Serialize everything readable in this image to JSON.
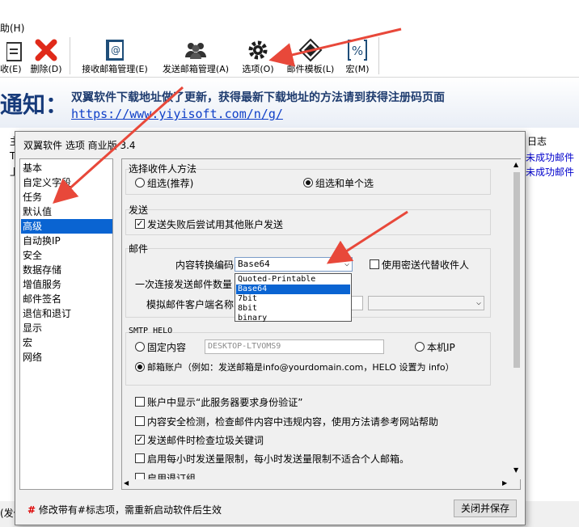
{
  "menubar": {
    "help_label": "助(H)"
  },
  "toolbar": {
    "items": [
      {
        "label": "收(E)",
        "icon": "receive-icon"
      },
      {
        "label": "删除(D)",
        "icon": "delete-x-icon"
      },
      {
        "label": "接收邮箱管理(E)",
        "icon": "receive-mailbox-icon"
      },
      {
        "label": "发送邮箱管理(A)",
        "icon": "users-icon"
      },
      {
        "label": "选项(O)",
        "icon": "gear-icon"
      },
      {
        "label": "邮件模板(L)",
        "icon": "template-icon"
      },
      {
        "label": "宏(M)",
        "icon": "percent-macro-icon"
      }
    ]
  },
  "banner": {
    "title": "通知：",
    "text": "双翼软件下载地址做了更新，获得最新下载地址的方法请到获得注册码页面",
    "link": "https://www.yiyisoft.com/n/g/"
  },
  "backdrop": {
    "left_items": [
      "主",
      "T",
      "上"
    ],
    "log_header": "日志",
    "log_lines": [
      "未成功邮件",
      "未成功邮件"
    ],
    "status_text": "(发信"
  },
  "dialog": {
    "title": "双翼软件 选项 商业版 3.4",
    "nav_items": [
      "基本",
      "自定义字段",
      "任务",
      "默认值",
      "高级",
      "自动换IP",
      "安全",
      "数据存储",
      "增值服务",
      "邮件签名",
      "退信和退订",
      "显示",
      "宏",
      "网络"
    ],
    "selected_nav": "高级",
    "recipient_group": {
      "title": "选择收件人方法",
      "option1": "组选(推荐)",
      "option2": "组选和单个选",
      "selected": "组选和单个选"
    },
    "send_group": {
      "title": "发送",
      "retry_label": "发送失败后尝试用其他账户发送",
      "retry_checked": true
    },
    "mail_group": {
      "title": "邮件",
      "encoding_label": "内容转换编码",
      "encoding_value": "Base64",
      "encoding_options": [
        "Quoted-Printable",
        "Base64",
        "7bit",
        "8bit",
        "binary"
      ],
      "bcc_label": "使用密送代替收件人",
      "bcc_checked": false,
      "batch_label": "一次连接发送邮件数量",
      "client_label": "模拟邮件客户端名称"
    },
    "smtp_group": {
      "title": "SMTP HELO",
      "fixed_label": "固定内容",
      "fixed_value": "DESKTOP-LTVOMS9",
      "local_ip_label": "本机IP",
      "account_label": "邮箱账户（例如：发送邮箱是info@yourdomain.com，HELO 设置为 info）",
      "selected": "邮箱账户"
    },
    "options": [
      {
        "label": "账户中显示“此服务器要求身份验证”",
        "checked": false
      },
      {
        "label": "内容安全检测，检查邮件内容中违规内容，使用方法请参考网站帮助",
        "checked": false
      },
      {
        "label": "发送邮件时检查垃圾关键词",
        "checked": true
      },
      {
        "label": "启用每小时发送量限制，每小时发送量限制不适合个人邮箱。",
        "checked": false
      },
      {
        "label": "启用退订组",
        "checked": false
      }
    ],
    "hint_mark": "#",
    "hint_text": "修改带有#标志项，需重新启动软件后生效",
    "close_button": "关闭并保存"
  },
  "colors": {
    "selection": "#0a64d2",
    "annotation_arrow": "#e8483a",
    "link": "#1040c8"
  }
}
